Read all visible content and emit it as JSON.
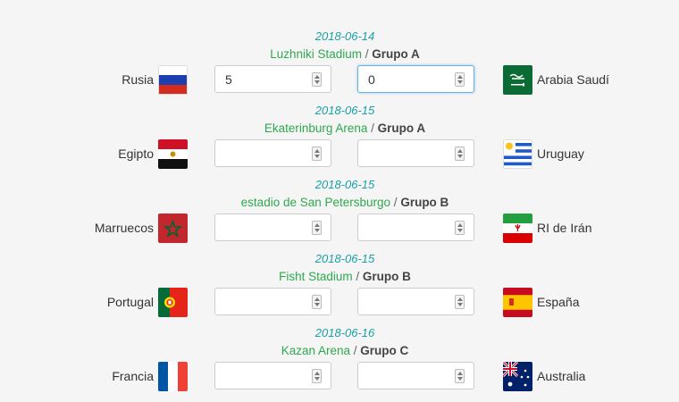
{
  "matches": [
    {
      "date": "2018-06-14",
      "stadium": "Luzhniki Stadium",
      "separator": " / ",
      "group": "Grupo A",
      "home_team": "Rusia",
      "away_team": "Arabia Saudí",
      "home_flag": "russia-flag-icon",
      "away_flag": "saudi-arabia-flag-icon",
      "home_score": "5",
      "away_score": "0"
    },
    {
      "date": "2018-06-15",
      "stadium": "Ekaterinburg Arena",
      "separator": " / ",
      "group": "Grupo A",
      "home_team": "Egipto",
      "away_team": "Uruguay",
      "home_flag": "egypt-flag-icon",
      "away_flag": "uruguay-flag-icon",
      "home_score": "",
      "away_score": ""
    },
    {
      "date": "2018-06-15",
      "stadium": "estadio de San Petersburgo",
      "separator": " / ",
      "group": "Grupo B",
      "home_team": "Marruecos",
      "away_team": "RI de Irán",
      "home_flag": "morocco-flag-icon",
      "away_flag": "iran-flag-icon",
      "home_score": "",
      "away_score": ""
    },
    {
      "date": "2018-06-15",
      "stadium": "Fisht Stadium",
      "separator": " / ",
      "group": "Grupo B",
      "home_team": "Portugal",
      "away_team": "España",
      "home_flag": "portugal-flag-icon",
      "away_flag": "spain-flag-icon",
      "home_score": "",
      "away_score": ""
    },
    {
      "date": "2018-06-16",
      "stadium": "Kazan Arena",
      "separator": " / ",
      "group": "Grupo C",
      "home_team": "Francia",
      "away_team": "Australia",
      "home_flag": "france-flag-icon",
      "away_flag": "australia-flag-icon",
      "home_score": "",
      "away_score": ""
    }
  ],
  "colors": {
    "date": "#1aa0a8",
    "stadium": "#2fa84f",
    "focus_border": "#66afe9"
  }
}
